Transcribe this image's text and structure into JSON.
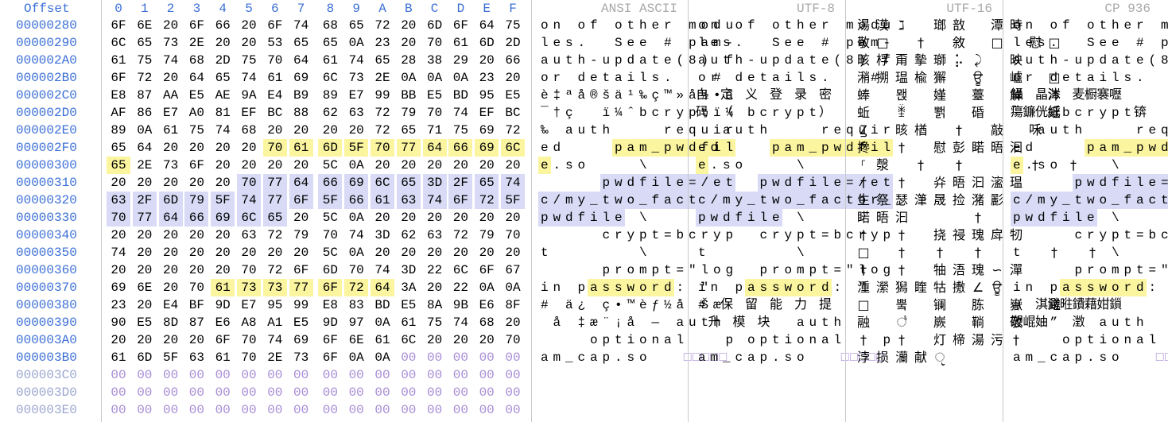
{
  "header": {
    "offset_label": "Offset",
    "hex_columns": [
      "0",
      "1",
      "2",
      "3",
      "4",
      "5",
      "6",
      "7",
      "8",
      "9",
      "A",
      "B",
      "C",
      "D",
      "E",
      "F"
    ],
    "panels": [
      "ANSI ASCII",
      "UTF-8",
      "UTF-16",
      "CP 936"
    ]
  },
  "colors": {
    "accent_blue": "#3b6fd6",
    "highlight_yellow": "#fbf59f",
    "highlight_blue": "#d8daf6",
    "empty_byte": "#a78bd6",
    "gridline": "#c8c8c8"
  },
  "rows": [
    {
      "offset": "00000280",
      "hex": "6F 6E 20 6F 66 20 6F 74 68 65 72 20 6D 6F 64 75",
      "ascii": "on of other modu",
      "utf8": "on of other modu",
      "utf16": "湯漠ℷ 瑯敨 潭時",
      "cp936": "on of other modu"
    },
    {
      "offset": "00000290",
      "hex": "6C 65 73 2E 20 20 53 65 65 0A 23 20 70 61 6D 2D",
      "ascii": "les.  See # pam-",
      "utf8": "les.  See # pam-",
      "utf16": "敬□ † 敘 □ 慰□",
      "cp936": "les.  See # pam-"
    },
    {
      "offset": "000002A0",
      "hex": "61 75 74 68 2D 75 70 64 61 74 65 28 38 29 20 66",
      "ascii": "auth-update(8) f",
      "utf8": "auth-update(8) f",
      "utf16": "畡桴甭摰瑡⡥⤸ 映",
      "cp936": "auth-update(8) f"
    },
    {
      "offset": "000002B0",
      "hex": "6F 72 20 64 65 74 61 69 6C 73 2E 0A 0A 0A 23 20",
      "ascii": "or details.   # ",
      "utf8": "or details.   # ",
      "utf16": "潲搠瑥楡獬 ਊ 㠠 □",
      "cp936": "or details.   # "
    },
    {
      "offset": "000002C0",
      "hex": "E8 87 AA E5 AE 9A E4 B9 89 E7 99 BB E5 BD 95 E5",
      "ascii": "è‡ªå®šä¹‰ç™»å½•å",
      "utf8": "自 定 义 登 录 密",
      "utf16": "蜯 뫥 嫤 薹 觧 泍",
      "cp936": "鑷 晶涔 麦橱褰嚦"
    },
    {
      "offset": "000002D0",
      "hex": "AF 86 E7 A0 81 EF BC 88 62 63 72 79 70 74 EF BC",
      "ascii": "¯†ç  ï¼ˆbcryptï¼",
      "utf8": "码 （ bcrypt）",
      "utf16": "蚯 ꃧ 뾁 碈 ︢ 婬",
      "cp936": "瘍鐮侊紙bcrypt锛"
    },
    {
      "offset": "000002E0",
      "hex": "89 0A 61 75 74 68 20 20 20 20 72 65 71 75 69 72",
      "ascii": "‰ auth    requir",
      "utf8": "  auth    requir",
      "utf16": "Ꙁ 晐楢 † 敲 咊",
      "cp936": "  auth    requir"
    },
    {
      "offset": "000002F0",
      "hex": "65 64 20 20 20 20 70 61 6D 5F 70 77 64 66 69 6C",
      "ascii": "ed    pam_pwdfil",
      "utf8": "ed    pam_pwdfil",
      "utf16": "搀 † 慰彭睰晤汩",
      "cp936": "ed    pam_pwdfil"
    },
    {
      "offset": "00000300",
      "hex": "65 2E 73 6F 20 20 20 20 5C 0A 20 20 20 20 20 20",
      "ascii": "e.so    \\      ",
      "utf8": "e.so    \\      ",
      "utf16": "⸀漀 † † ਀ † †",
      "cp936": "e.so    \\      "
    },
    {
      "offset": "00000310",
      "hex": "20 20 20 20 20 70 77 64 66 69 6C 65 3D 2F 65 74",
      "ascii": "     pwdfile=/et",
      "utf8": "     pwdfile=/et",
      "utf16": "† † 灷晤汩㵥瑥",
      "cp936": "     pwdfile=/et"
    },
    {
      "offset": "00000320",
      "hex": "63 2F 6D 79 5F 74 77 6F 5F 66 61 63 74 6F 72 5F",
      "ascii": "c/my_two_factor_",
      "utf8": "c/my_two_factor_",
      "utf16": "⽣祭瑟潷晟捡潴彲",
      "cp936": "c/my_two_factor_"
    },
    {
      "offset": "00000330",
      "hex": "70 77 64 66 69 6C 65 20 5C 0A 20 20 20 20 20 20",
      "ascii": "pwdfile \\       ",
      "utf8": "pwdfile \\       ",
      "utf16": "睰晤汩⁥਀ † †",
      "cp936": "pwdfile \\       "
    },
    {
      "offset": "00000340",
      "hex": "20 20 20 20 20 63 72 79 70 74 3D 62 63 72 79 70",
      "ascii": "     crypt=bcryp",
      "utf8": "     crypt=bcryp",
      "utf16": "† † 挠祲瑰戽牣",
      "cp936": "     crypt=bcryp"
    },
    {
      "offset": "00000350",
      "hex": "74 20 20 20 20 20 20 20 5C 0A 20 20 20 20 20 20",
      "ascii": "t       \\       ",
      "utf8": "t       \\       ",
      "utf16": "□ † † † ਀ † †",
      "cp936": "t       \\       "
    },
    {
      "offset": "00000360",
      "hex": "20 20 20 20 20 70 72 6F 6D 70 74 3D 22 6C 6F 67",
      "ascii": "     prompt=\"log",
      "utf8": "     prompt=\"log",
      "utf16": "† † 牰浯瑰∽潬",
      "cp936": "     prompt=\"log"
    },
    {
      "offset": "00000370",
      "hex": "69 6E 20 70 61 73 73 77 6F 72 64 3A 20 22 0A 0A",
      "ascii": "in password: \"  ",
      "utf8": "in password: \"  ",
      "utf16": "湩瀠獡睳牯㩤∠ਊ",
      "cp936": "in password: \"  "
    },
    {
      "offset": "00000380",
      "hex": "23 20 E4 BF 9D E7 95 99 E8 83 BD E5 8A 9B E6 8F",
      "ascii": "# ä¿ ç•™èƒ½å Šæ",
      "utf8": "# 保 留 能 力 提",
      "utf16": "□ 뿤 镧 胨 嶽 鎈",
      "cp936": "# 淇濈暀鐨藉姏鎻"
    },
    {
      "offset": "00000390",
      "hex": "90 E5 8D 87 E6 A8 A1 E5 9D 97 0A 61 75 74 68 20",
      "ascii": " å ‡æ¨¡å — auth ",
      "utf8": " 升 模 块  auth ",
      "utf16": "融 ꣦ 嶡 鞝 敬",
      "cp936": "愬崐妯” 澂 auth "
    },
    {
      "offset": "000003A0",
      "hex": "20 20 20 20 6F 70 74 69 6F 6E 61 6C 20 20 20 70",
      "ascii": "    optional   p",
      "utf8": "    optional   p",
      "utf16": "† † 灯楴湯污†",
      "cp936": "    optional   p"
    },
    {
      "offset": "000003B0",
      "hex": "61 6D 5F 63 61 70 2E 73 6F 0A 0A",
      "ascii": "am_cap.so  ",
      "utf8": "am_cap.so  ",
      "utf16": "浡损灡献ੵ",
      "cp936": "am_cap.so  "
    },
    {
      "offset": "000003C0",
      "hex": "",
      "ascii": "",
      "utf8": "",
      "utf16": "",
      "cp936": ""
    },
    {
      "offset": "000003D0",
      "hex": "",
      "ascii": "",
      "utf8": "",
      "utf16": "",
      "cp936": ""
    },
    {
      "offset": "000003E0",
      "hex": "",
      "ascii": "",
      "utf8": "",
      "utf16": "",
      "cp936": ""
    }
  ],
  "empty_byte": "00",
  "empty_glyph": "□"
}
